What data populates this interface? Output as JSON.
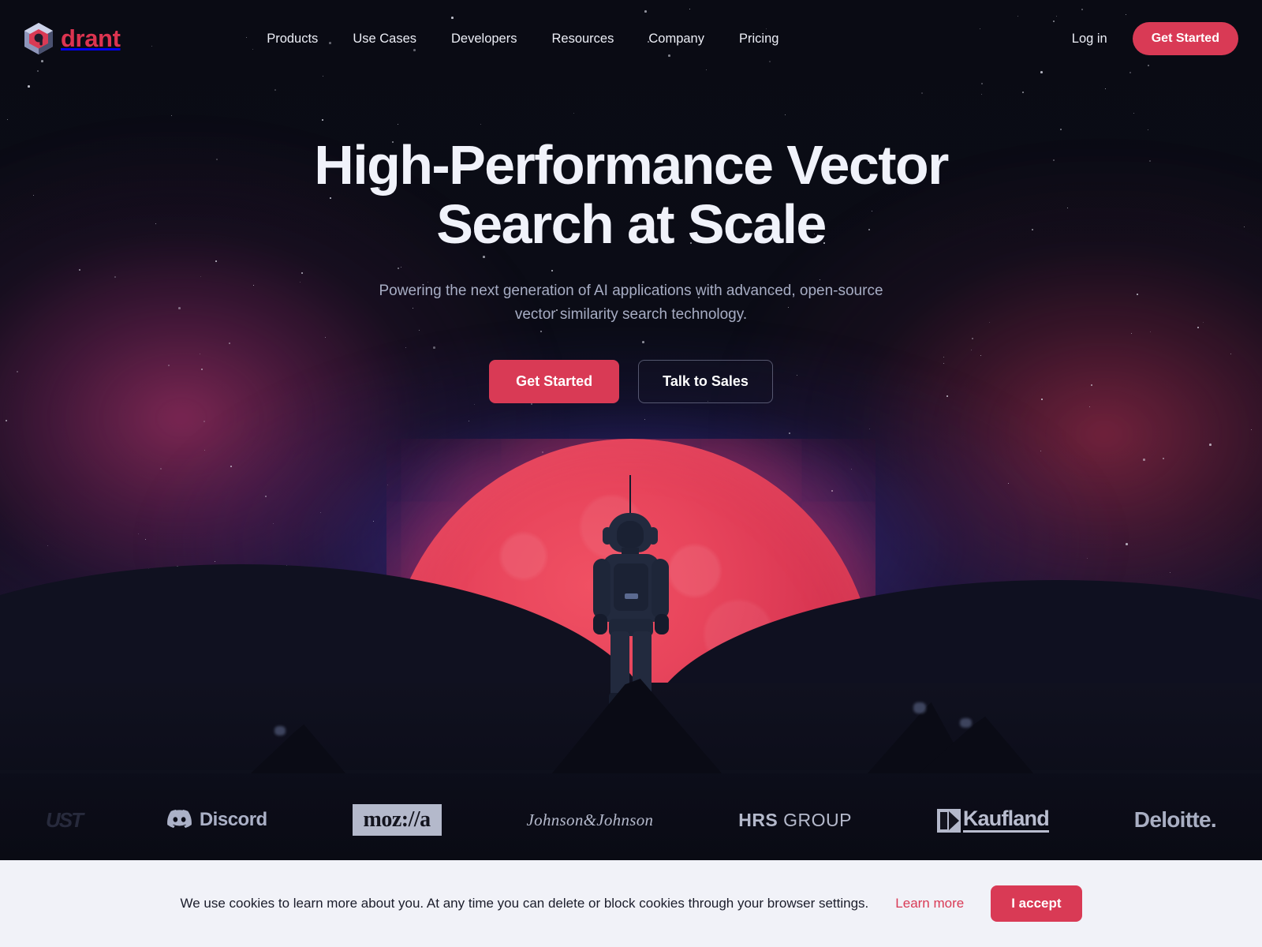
{
  "brand": {
    "name": "drant",
    "logo_icon": "qdrant-cube-logo-icon",
    "accent_color": "#d93a55"
  },
  "header": {
    "nav": [
      {
        "label": "Products"
      },
      {
        "label": "Use Cases"
      },
      {
        "label": "Developers"
      },
      {
        "label": "Resources"
      },
      {
        "label": "Company"
      },
      {
        "label": "Pricing"
      }
    ],
    "login_label": "Log in",
    "cta_label": "Get Started"
  },
  "hero": {
    "headline": "High-Performance Vector Search at Scale",
    "subheadline": "Powering the next generation of AI applications with advanced, open-source vector similarity search technology.",
    "primary_cta": "Get Started",
    "secondary_cta": "Talk to Sales"
  },
  "logos": [
    {
      "name": "UST",
      "label": "UST"
    },
    {
      "name": "Discord",
      "label": "Discord"
    },
    {
      "name": "Mozilla",
      "label": "moz://a"
    },
    {
      "name": "Johnson & Johnson",
      "label": "Johnson&Johnson"
    },
    {
      "name": "HRS Group",
      "label_bold": "HRS",
      "label_light": "GROUP"
    },
    {
      "name": "Kaufland",
      "label": "Kaufland"
    },
    {
      "name": "Deloitte",
      "label": "Deloitte."
    }
  ],
  "cookie": {
    "message": "We use cookies to learn more about you. At any time you can delete or block cookies through your browser settings.",
    "learn_more": "Learn more",
    "accept": "I accept"
  },
  "scene": {
    "planet_color": "#e8455c",
    "sky_top": "#0a0b14",
    "aurora_left": "#d63c82",
    "aurora_right": "#d6375f",
    "aurora_center": "#5c4ee0"
  }
}
